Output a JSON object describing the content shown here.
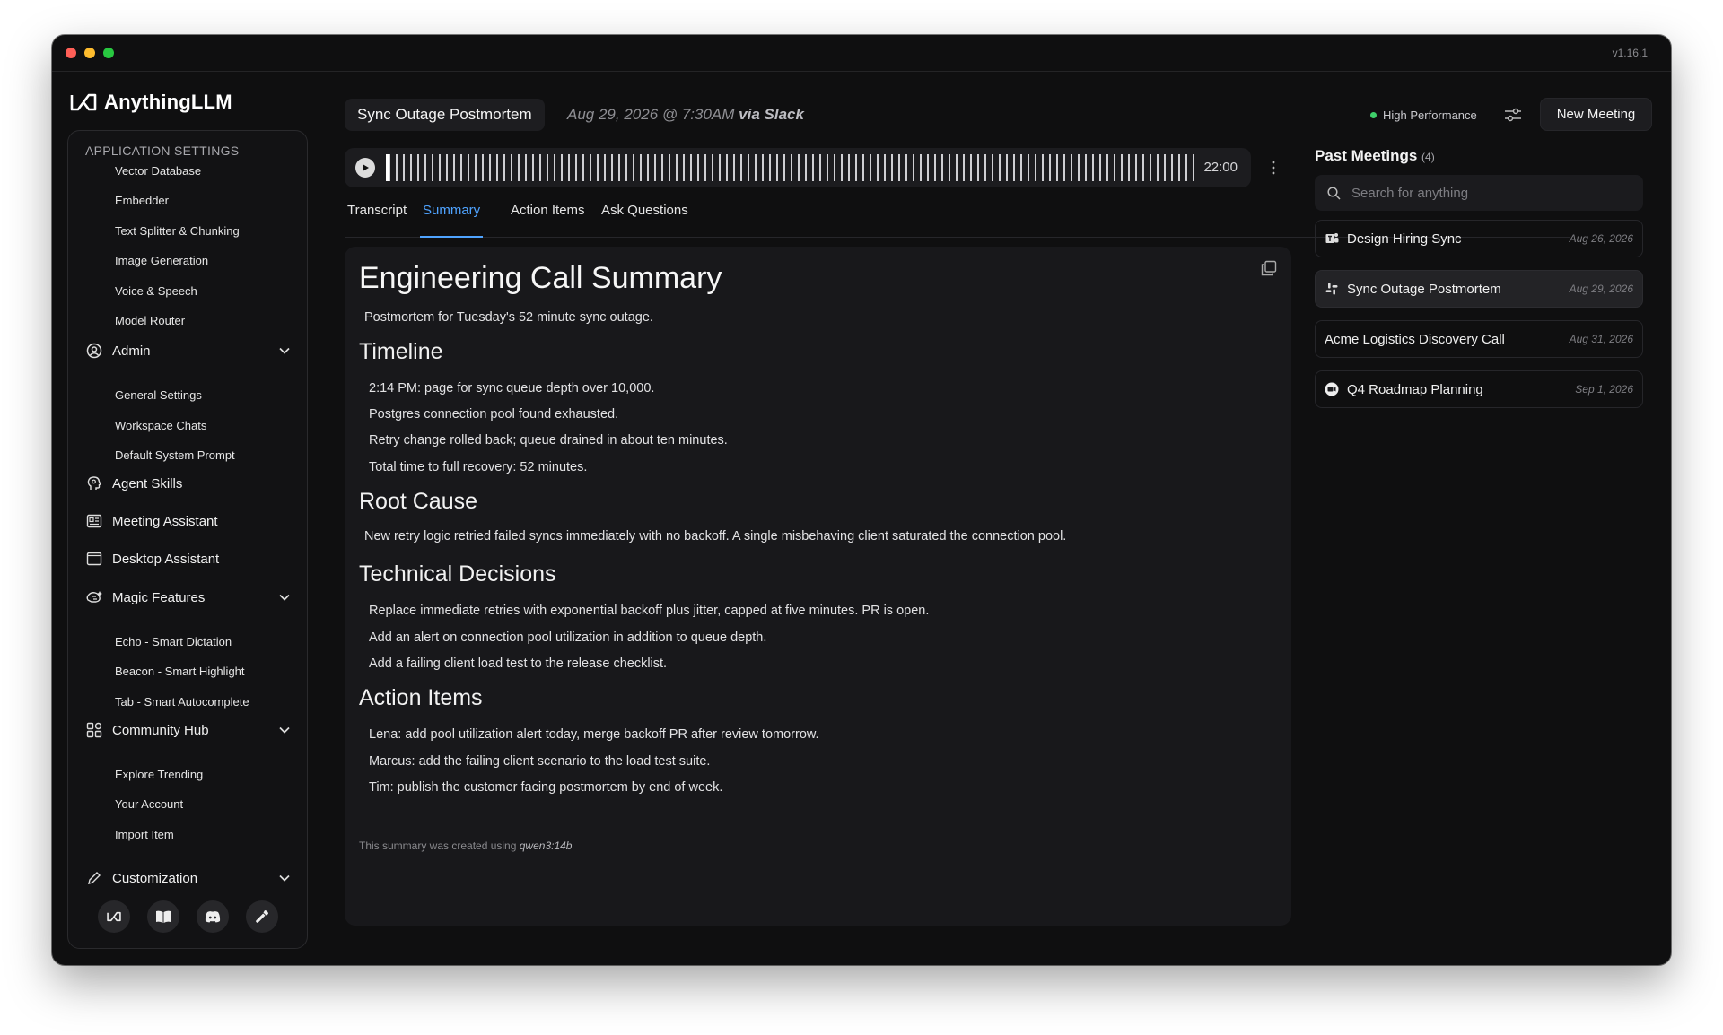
{
  "window": {
    "version": "v1.16.1"
  },
  "brand": {
    "name": "AnythingLLM"
  },
  "sidebar": {
    "heading": "APPLICATION SETTINGS",
    "app_items": [
      "Vector Database",
      "Embedder",
      "Text Splitter & Chunking",
      "Image Generation",
      "Voice & Speech",
      "Model Router"
    ],
    "admin": {
      "label": "Admin",
      "items": [
        "General Settings",
        "Workspace Chats",
        "Default System Prompt"
      ]
    },
    "agent_skills": "Agent Skills",
    "meeting_assistant": "Meeting Assistant",
    "desktop_assistant": "Desktop Assistant",
    "magic_features": {
      "label": "Magic Features",
      "items": [
        "Echo - Smart Dictation",
        "Beacon - Smart Highlight",
        "Tab - Smart Autocomplete"
      ]
    },
    "community_hub": {
      "label": "Community Hub",
      "items": [
        "Explore Trending",
        "Your Account",
        "Import Item"
      ]
    },
    "customization": "Customization"
  },
  "header": {
    "title": "Sync Outage Postmortem",
    "meta_date": "Aug 29, 2026 @ 7:30AM",
    "meta_source": "via Slack",
    "performance": "High Performance",
    "new_meeting": "New Meeting"
  },
  "player": {
    "duration": "22:00"
  },
  "tabs": [
    "Transcript",
    "Summary",
    "Action Items",
    "Ask Questions"
  ],
  "summary": {
    "title": "Engineering Call Summary",
    "subtitle": "Postmortem for Tuesday's 52 minute sync outage.",
    "timeline_heading": "Timeline",
    "timeline": [
      "2:14 PM: page for sync queue depth over 10,000.",
      "Postgres connection pool found exhausted.",
      "Retry change rolled back; queue drained in about ten minutes.",
      "Total time to full recovery: 52 minutes."
    ],
    "root_cause_heading": "Root Cause",
    "root_cause": "New retry logic retried failed syncs immediately with no backoff. A single misbehaving client saturated the connection pool.",
    "decisions_heading": "Technical Decisions",
    "decisions": [
      "Replace immediate retries with exponential backoff plus jitter, capped at five minutes. PR is open.",
      "Add an alert on connection pool utilization in addition to queue depth.",
      "Add a failing client load test to the release checklist."
    ],
    "actions_heading": "Action Items",
    "actions": [
      "Lena: add pool utilization alert today, merge backoff PR after review tomorrow.",
      "Marcus: add the failing client scenario to the load test suite.",
      "Tim: publish the customer facing postmortem by end of week."
    ],
    "footer_prefix": "This summary was created using",
    "footer_model": "qwen3:14b"
  },
  "past_meetings": {
    "title": "Past Meetings",
    "count": "(4)",
    "search_placeholder": "Search for anything",
    "items": [
      {
        "title": "Design Hiring Sync",
        "date": "Aug 26, 2026",
        "icon": "teams-icon"
      },
      {
        "title": "Sync Outage Postmortem",
        "date": "Aug 29, 2026",
        "icon": "slack-icon"
      },
      {
        "title": "Acme Logistics Discovery Call",
        "date": "Aug 31, 2026",
        "icon": ""
      },
      {
        "title": "Q4 Roadmap Planning",
        "date": "Sep 1, 2026",
        "icon": "zoom-icon"
      }
    ]
  },
  "colors": {
    "accent": "#4fa3ff",
    "status_green": "#3ecf6a",
    "background": "#0f0f10"
  }
}
